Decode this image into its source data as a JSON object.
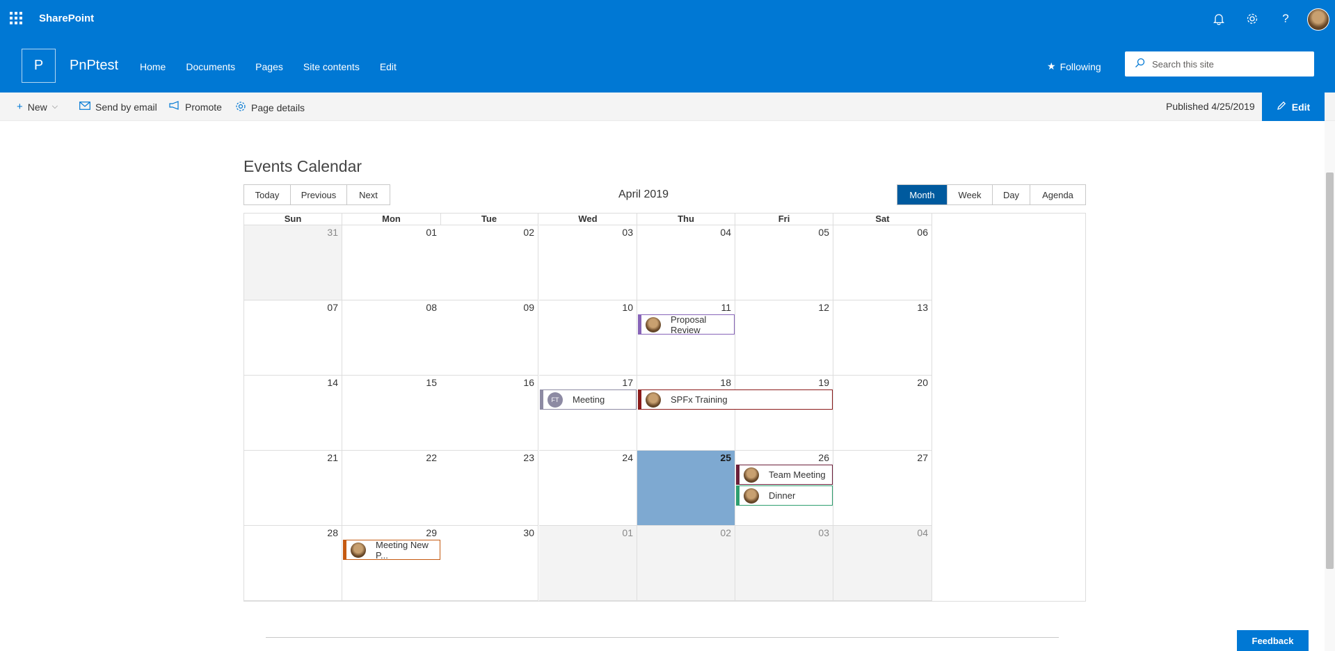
{
  "suitebar": {
    "brand": "SharePoint",
    "icons": [
      "waffle-icon",
      "bell-icon",
      "gear-icon",
      "help-icon",
      "avatar"
    ]
  },
  "site": {
    "logo_letter": "P",
    "name": "PnPtest",
    "nav": [
      "Home",
      "Documents",
      "Pages",
      "Site contents",
      "Edit"
    ],
    "following": "Following",
    "search_placeholder": "Search this site"
  },
  "commandbar": {
    "new": "New",
    "send_by_email": "Send by email",
    "promote": "Promote",
    "page_details": "Page details",
    "published": "Published 4/25/2019",
    "edit": "Edit"
  },
  "calendar": {
    "title": "Events Calendar",
    "nav_buttons": [
      "Today",
      "Previous",
      "Next"
    ],
    "month_label": "April 2019",
    "views": [
      "Month",
      "Week",
      "Day",
      "Agenda"
    ],
    "active_view": "Month",
    "weekdays": [
      "Sun",
      "Mon",
      "Tue",
      "Wed",
      "Thu",
      "Fri",
      "Sat"
    ],
    "weeks": [
      [
        {
          "d": "31",
          "off": true
        },
        {
          "d": "01"
        },
        {
          "d": "02"
        },
        {
          "d": "03"
        },
        {
          "d": "04"
        },
        {
          "d": "05"
        },
        {
          "d": "06"
        }
      ],
      [
        {
          "d": "07"
        },
        {
          "d": "08"
        },
        {
          "d": "09"
        },
        {
          "d": "10"
        },
        {
          "d": "11"
        },
        {
          "d": "12"
        },
        {
          "d": "13"
        }
      ],
      [
        {
          "d": "14"
        },
        {
          "d": "15"
        },
        {
          "d": "16"
        },
        {
          "d": "17"
        },
        {
          "d": "18"
        },
        {
          "d": "19"
        },
        {
          "d": "20"
        }
      ],
      [
        {
          "d": "21"
        },
        {
          "d": "22"
        },
        {
          "d": "23"
        },
        {
          "d": "24"
        },
        {
          "d": "25",
          "today": true
        },
        {
          "d": "26"
        },
        {
          "d": "27"
        }
      ],
      [
        {
          "d": "28"
        },
        {
          "d": "29"
        },
        {
          "d": "30"
        },
        {
          "d": "01",
          "off": true
        },
        {
          "d": "02",
          "off": true
        },
        {
          "d": "03",
          "off": true
        },
        {
          "d": "04",
          "off": true
        }
      ]
    ],
    "events": [
      {
        "title": "Proposal Review",
        "week": 1,
        "day": 4,
        "span": 1,
        "slot": 0,
        "color": "#8764b8",
        "avatar": "photo"
      },
      {
        "title": "Meeting",
        "week": 2,
        "day": 3,
        "span": 1,
        "slot": 0,
        "color": "#8d8aa3",
        "avatar": "FT"
      },
      {
        "title": "SPFx Training",
        "week": 2,
        "day": 4,
        "span": 2,
        "slot": 0,
        "color": "#8b1a1a",
        "avatar": "photo"
      },
      {
        "title": "Team Meeting",
        "week": 3,
        "day": 5,
        "span": 1,
        "slot": 0,
        "color": "#6b1f3a",
        "avatar": "photo"
      },
      {
        "title": "Dinner",
        "week": 3,
        "day": 5,
        "span": 1,
        "slot": 1,
        "color": "#2e9e6e",
        "avatar": "photo"
      },
      {
        "title": "Meeting New P...",
        "week": 4,
        "day": 1,
        "span": 1,
        "slot": 0,
        "color": "#c55a11",
        "avatar": "photo"
      }
    ]
  },
  "footer": {
    "feedback": "Feedback"
  }
}
